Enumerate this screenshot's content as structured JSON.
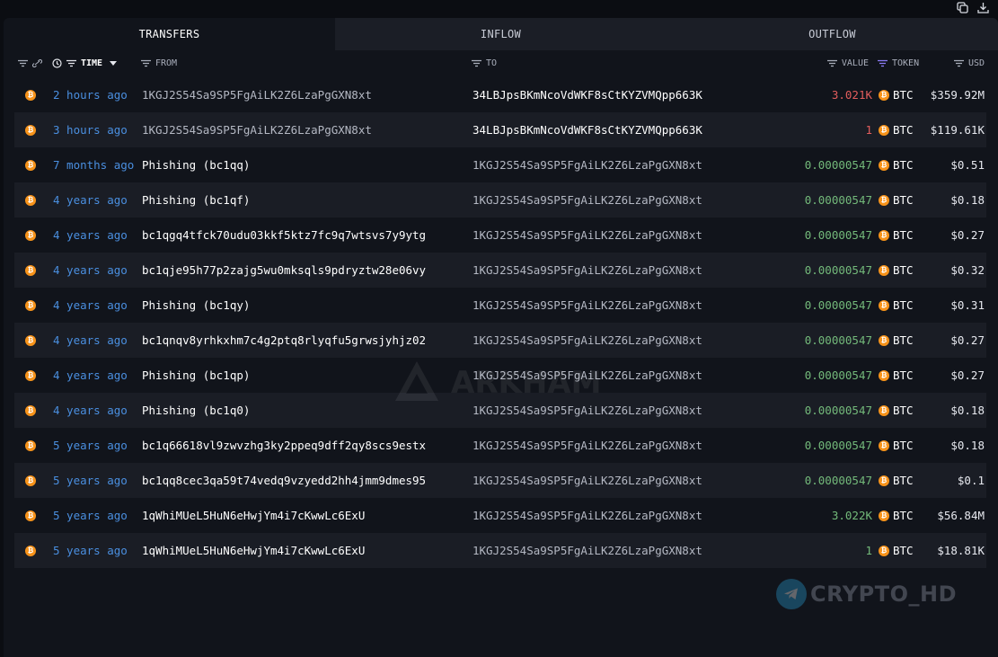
{
  "tabs": [
    {
      "label": "TRANSFERS",
      "active": true
    },
    {
      "label": "INFLOW",
      "active": false
    },
    {
      "label": "OUTFLOW",
      "active": false
    }
  ],
  "columns": {
    "time": "TIME",
    "from": "FROM",
    "to": "TO",
    "value": "VALUE",
    "token": "TOKEN",
    "usd": "USD"
  },
  "rows": [
    {
      "time": "2 hours ago",
      "from": "1KGJ2S54Sa9SP5FgAiLK2Z6LzaPgGXN8xt",
      "to": "34LBJpsBKmNcoVdWKF8sCtKYZVMQpp663K",
      "value": "3.021K",
      "direction": "out",
      "token": "BTC",
      "usd": "$359.92M"
    },
    {
      "time": "3 hours ago",
      "from": "1KGJ2S54Sa9SP5FgAiLK2Z6LzaPgGXN8xt",
      "to": "34LBJpsBKmNcoVdWKF8sCtKYZVMQpp663K",
      "value": "1",
      "direction": "out",
      "token": "BTC",
      "usd": "$119.61K"
    },
    {
      "time": "7 months ago",
      "from": "Phishing (bc1qq)",
      "to": "1KGJ2S54Sa9SP5FgAiLK2Z6LzaPgGXN8xt",
      "value": "0.00000547",
      "direction": "in",
      "token": "BTC",
      "usd": "$0.51"
    },
    {
      "time": "4 years ago",
      "from": "Phishing (bc1qf)",
      "to": "1KGJ2S54Sa9SP5FgAiLK2Z6LzaPgGXN8xt",
      "value": "0.00000547",
      "direction": "in",
      "token": "BTC",
      "usd": "$0.18"
    },
    {
      "time": "4 years ago",
      "from": "bc1qgq4tfck70udu03kkf5ktz7fc9q7wtsvs7y9ytg",
      "to": "1KGJ2S54Sa9SP5FgAiLK2Z6LzaPgGXN8xt",
      "value": "0.00000547",
      "direction": "in",
      "token": "BTC",
      "usd": "$0.27"
    },
    {
      "time": "4 years ago",
      "from": "bc1qje95h77p2zajg5wu0mksqls9pdryztw28e06vy",
      "to": "1KGJ2S54Sa9SP5FgAiLK2Z6LzaPgGXN8xt",
      "value": "0.00000547",
      "direction": "in",
      "token": "BTC",
      "usd": "$0.32"
    },
    {
      "time": "4 years ago",
      "from": "Phishing (bc1qy)",
      "to": "1KGJ2S54Sa9SP5FgAiLK2Z6LzaPgGXN8xt",
      "value": "0.00000547",
      "direction": "in",
      "token": "BTC",
      "usd": "$0.31"
    },
    {
      "time": "4 years ago",
      "from": "bc1qnqv8yrhkxhm7c4g2ptq8rlyqfu5grwsjyhjz02",
      "to": "1KGJ2S54Sa9SP5FgAiLK2Z6LzaPgGXN8xt",
      "value": "0.00000547",
      "direction": "in",
      "token": "BTC",
      "usd": "$0.27"
    },
    {
      "time": "4 years ago",
      "from": "Phishing (bc1qp)",
      "to": "1KGJ2S54Sa9SP5FgAiLK2Z6LzaPgGXN8xt",
      "value": "0.00000547",
      "direction": "in",
      "token": "BTC",
      "usd": "$0.27"
    },
    {
      "time": "4 years ago",
      "from": "Phishing (bc1q0)",
      "to": "1KGJ2S54Sa9SP5FgAiLK2Z6LzaPgGXN8xt",
      "value": "0.00000547",
      "direction": "in",
      "token": "BTC",
      "usd": "$0.18"
    },
    {
      "time": "5 years ago",
      "from": "bc1q66618vl9zwvzhg3ky2ppeq9dff2qy8scs9estx",
      "to": "1KGJ2S54Sa9SP5FgAiLK2Z6LzaPgGXN8xt",
      "value": "0.00000547",
      "direction": "in",
      "token": "BTC",
      "usd": "$0.18"
    },
    {
      "time": "5 years ago",
      "from": "bc1qq8cec3qa59t74vedq9vzyedd2hh4jmm9dmes95",
      "to": "1KGJ2S54Sa9SP5FgAiLK2Z6LzaPgGXN8xt",
      "value": "0.00000547",
      "direction": "in",
      "token": "BTC",
      "usd": "$0.1"
    },
    {
      "time": "5 years ago",
      "from": "1qWhiMUeL5HuN6eHwjYm4i7cKwwLc6ExU",
      "to": "1KGJ2S54Sa9SP5FgAiLK2Z6LzaPgGXN8xt",
      "value": "3.022K",
      "direction": "in",
      "token": "BTC",
      "usd": "$56.84M"
    },
    {
      "time": "5 years ago",
      "from": "1qWhiMUeL5HuN6eHwjYm4i7cKwwLc6ExU",
      "to": "1KGJ2S54Sa9SP5FgAiLK2Z6LzaPgGXN8xt",
      "value": "1",
      "direction": "in",
      "token": "BTC",
      "usd": "$18.81K"
    }
  ],
  "watermark": "ARKHAM",
  "credit": "CRYPTO_HD",
  "colors": {
    "time_link": "#4a8fe0",
    "value_out": "#e25d5d",
    "value_in": "#73b97a",
    "btc": "#f7931a"
  }
}
